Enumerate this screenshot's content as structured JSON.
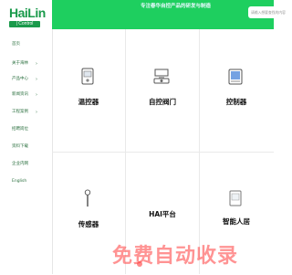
{
  "logo": {
    "name": "HaiLin",
    "sub": "| Control"
  },
  "header": {
    "title": "专注春华自控产品的研发与制造",
    "search_placeholder": "请输入想要查找的内容"
  },
  "sidebar": {
    "items": [
      {
        "label": "首页",
        "has_children": false
      },
      {
        "label": "关于海林",
        "has_children": true
      },
      {
        "label": "产品中心",
        "has_children": true
      },
      {
        "label": "新闻资讯",
        "has_children": true
      },
      {
        "label": "工程案例",
        "has_children": true
      },
      {
        "label": "招聘岗位",
        "has_children": false
      },
      {
        "label": "资料下载",
        "has_children": false
      },
      {
        "label": "企业内网",
        "has_children": false
      },
      {
        "label": "English",
        "has_children": false
      }
    ]
  },
  "products": [
    {
      "label": "温控器",
      "icon": "thermostat-icon"
    },
    {
      "label": "自控阀门",
      "icon": "valve-icon"
    },
    {
      "label": "控制器",
      "icon": "controller-icon"
    },
    {
      "label": "传感器",
      "icon": "sensor-icon"
    },
    {
      "label": "HAI平台",
      "icon": ""
    },
    {
      "label": "智能人居",
      "icon": "smart-home-icon"
    }
  ],
  "watermark": {
    "text": "免费自动收录"
  },
  "colors": {
    "brand": "#1a9a4b",
    "header": "#1ecf5f",
    "watermark": "#ff3b3b"
  }
}
